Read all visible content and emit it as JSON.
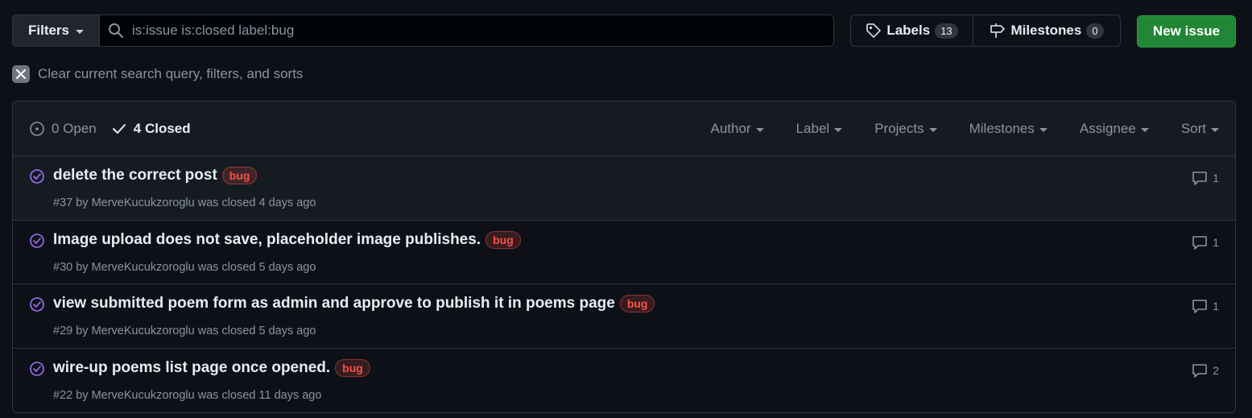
{
  "toolbar": {
    "filters_label": "Filters",
    "search_value": "is:issue is:closed label:bug",
    "labels_label": "Labels",
    "labels_count": "13",
    "milestones_label": "Milestones",
    "milestones_count": "0",
    "new_issue_label": "New issue",
    "clear_text": "Clear current search query, filters, and sorts"
  },
  "header": {
    "open_label": "0 Open",
    "closed_label": "4 Closed",
    "filters": [
      "Author",
      "Label",
      "Projects",
      "Milestones",
      "Assignee",
      "Sort"
    ]
  },
  "issues": [
    {
      "title": "delete the correct post",
      "label": "bug",
      "meta": "#37 by MerveKucukzoroglu was closed 4 days ago",
      "comments": "1"
    },
    {
      "title": "Image upload does not save, placeholder image publishes.",
      "label": "bug",
      "meta": "#30 by MerveKucukzoroglu was closed 5 days ago",
      "comments": "1"
    },
    {
      "title": "view submitted poem form as admin and approve to publish it in poems page",
      "label": "bug",
      "meta": "#29 by MerveKucukzoroglu was closed 5 days ago",
      "comments": "1"
    },
    {
      "title": "wire-up poems list page once opened.",
      "label": "bug",
      "meta": "#22 by MerveKucukzoroglu was closed 11 days ago",
      "comments": "2"
    }
  ],
  "colors": {
    "background": "#0d1117",
    "accent_green": "#238636",
    "closed_purple": "#a371f7",
    "bug_red": "#f85149"
  }
}
